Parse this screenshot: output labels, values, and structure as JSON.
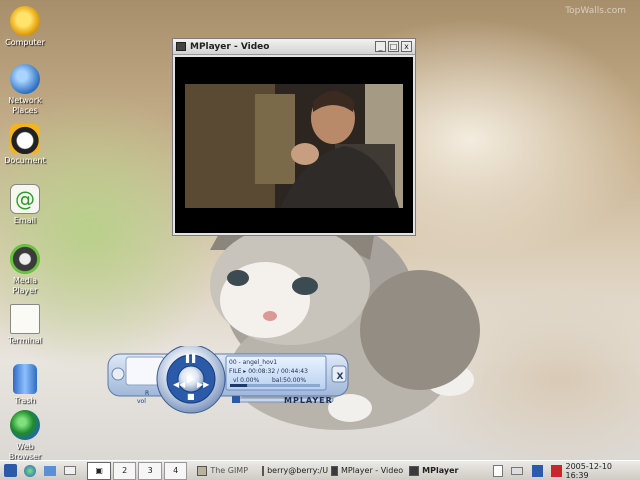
{
  "desktop": {
    "watermark": "TopWalls.com",
    "icons": [
      {
        "label": "Computer",
        "icon": "computer-icon"
      },
      {
        "label": "Network\nPlaces",
        "icon": "network-places-icon"
      },
      {
        "label": "Document",
        "icon": "document-icon"
      },
      {
        "label": "Email",
        "icon": "email-icon"
      },
      {
        "label": "Media\nPlayer",
        "icon": "media-player-icon"
      },
      {
        "label": "Terminal",
        "icon": "terminal-icon"
      },
      {
        "label": "Trash",
        "icon": "trash-icon"
      },
      {
        "label": "Web\nBrowser",
        "icon": "web-browser-icon"
      }
    ]
  },
  "video_window": {
    "title": "MPlayer - Video",
    "buttons": {
      "minimize": "_",
      "maximize": "□",
      "close": "x"
    }
  },
  "mplayer_skin": {
    "track": "00 - angel_hov1",
    "file_label": "FILE",
    "time": "00:08:32 / 00:44:43",
    "volume": "vl 0.00%",
    "balance": "bal:50.00%",
    "brand": "MPLAYER",
    "close_label": "X",
    "small_labels": {
      "vol": "vol",
      "r": "R"
    },
    "progress": 0.19
  },
  "taskbar": {
    "desktops": [
      "2",
      "3",
      "4"
    ],
    "active_desktop_icon": "pager-desktop-1",
    "tasks": [
      {
        "label": "The GIMP",
        "icon": "gimp-icon"
      },
      {
        "label": "berry@berry:/UL",
        "icon": "terminal-icon"
      },
      {
        "label": "MPlayer - Video",
        "icon": "mplayer-icon"
      },
      {
        "label": "MPlayer",
        "icon": "mplayer-icon",
        "bold": true
      }
    ],
    "clock": "2005-12-10 16:39"
  }
}
